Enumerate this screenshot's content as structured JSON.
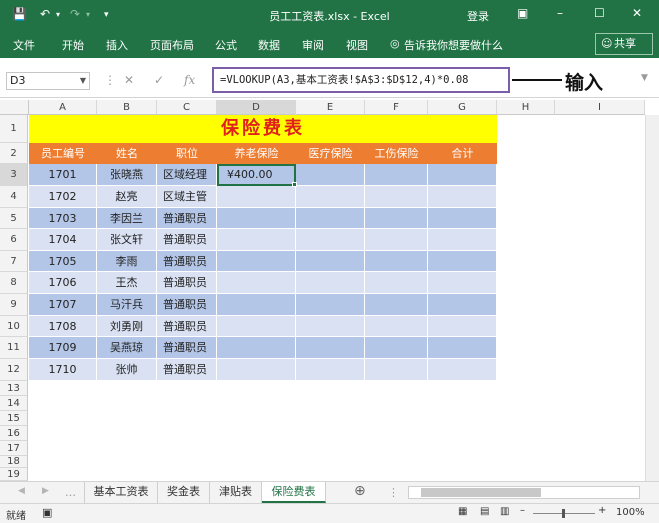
{
  "titlebar": {
    "title": "员工工资表.xlsx - Excel",
    "login": "登录",
    "save_icon": "save-icon",
    "undo_icon": "undo-icon",
    "redo_icon": "redo-icon"
  },
  "ribbon": {
    "tabs": [
      "文件",
      "开始",
      "插入",
      "页面布局",
      "公式",
      "数据",
      "审阅",
      "视图"
    ],
    "tell_me": "告诉我你想要做什么",
    "share": "共享"
  },
  "formula_bar": {
    "name_box": "D3",
    "formula": "=VLOOKUP(A3,基本工资表!$A$3:$D$12,4)*0.08",
    "annotation": "输入"
  },
  "columns": [
    "A",
    "B",
    "C",
    "D",
    "E",
    "F",
    "G",
    "H",
    "I"
  ],
  "rows": [
    "1",
    "2",
    "3",
    "4",
    "5",
    "6",
    "7",
    "8",
    "9",
    "10",
    "11",
    "12",
    "13",
    "14",
    "15",
    "16",
    "17",
    "18",
    "19"
  ],
  "sheet_title": "保险费表",
  "headers": [
    "员工编号",
    "姓名",
    "职位",
    "养老保险",
    "医疗保险",
    "工伤保险",
    "合计"
  ],
  "data_rows": [
    {
      "id": "1701",
      "name": "张晓燕",
      "role": "区域经理",
      "pension": "¥400.00"
    },
    {
      "id": "1702",
      "name": "赵亮",
      "role": "区域主管",
      "pension": ""
    },
    {
      "id": "1703",
      "name": "李因兰",
      "role": "普通职员",
      "pension": ""
    },
    {
      "id": "1704",
      "name": "张文轩",
      "role": "普通职员",
      "pension": ""
    },
    {
      "id": "1705",
      "name": "李雨",
      "role": "普通职员",
      "pension": ""
    },
    {
      "id": "1706",
      "name": "王杰",
      "role": "普通职员",
      "pension": ""
    },
    {
      "id": "1707",
      "name": "马汗兵",
      "role": "普通职员",
      "pension": ""
    },
    {
      "id": "1708",
      "name": "刘勇刚",
      "role": "普通职员",
      "pension": ""
    },
    {
      "id": "1709",
      "name": "吴燕琼",
      "role": "普通职员",
      "pension": ""
    },
    {
      "id": "1710",
      "name": "张帅",
      "role": "普通职员",
      "pension": ""
    }
  ],
  "sheets": [
    "基本工资表",
    "奖金表",
    "津贴表",
    "保险费表"
  ],
  "active_sheet": "保险费表",
  "status": {
    "mode": "就绪",
    "zoom": "100%"
  },
  "colors": {
    "accent": "#217346",
    "header_fill": "#ed7d31",
    "title_fill": "#ffff00",
    "title_text": "#e0201b",
    "band_dark": "#b4c6e7",
    "band_light": "#d9e1f2",
    "annotation_border": "#7b5ea7"
  }
}
